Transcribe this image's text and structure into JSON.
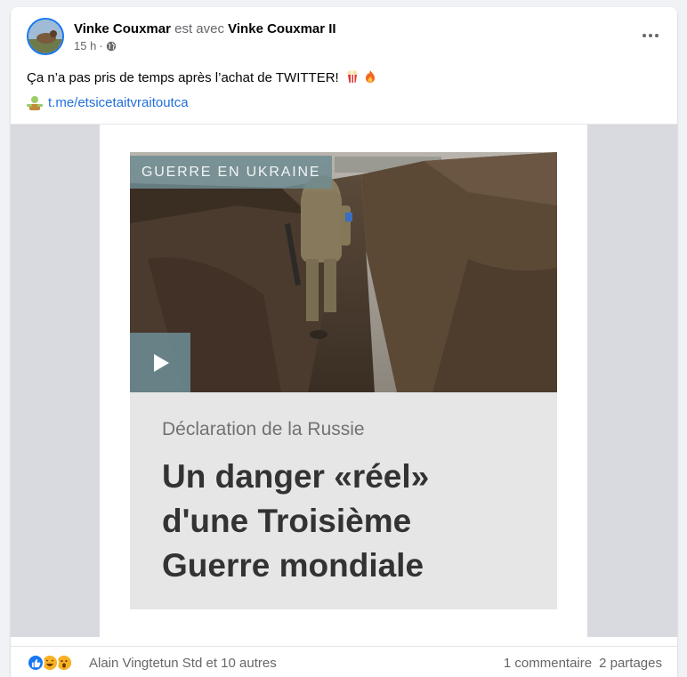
{
  "post": {
    "author": "Vinke Couxmar",
    "with_text": "est avec",
    "tagged": "Vinke Couxmar II",
    "time": "15 h",
    "dot": "·",
    "privacy_icon": "globe-icon",
    "text": "Ça n’a pas pris de temps après l’achat de TWITTER!",
    "emojis": [
      "popcorn-icon",
      "fire-icon"
    ],
    "link_icon": "zombie-icon",
    "link": "t.me/etsicetaitvraitoutca"
  },
  "media": {
    "tag": "GUERRE EN UKRAINE",
    "subtitle": "Déclaration de la Russie",
    "headline_lines": [
      "Un danger «réel»",
      "d'une Troisième",
      "Guerre mondiale"
    ]
  },
  "footer": {
    "reaction_icons": [
      "like-icon",
      "haha-icon",
      "wow-icon"
    ],
    "reaction_names": "Alain Vingtetun Std et 10 autres",
    "comments": "1 commentaire",
    "shares": "2 partages"
  },
  "colors": {
    "link": "#216fdb",
    "accent": "#1877f2",
    "tag_bg": "#6e8c91"
  }
}
